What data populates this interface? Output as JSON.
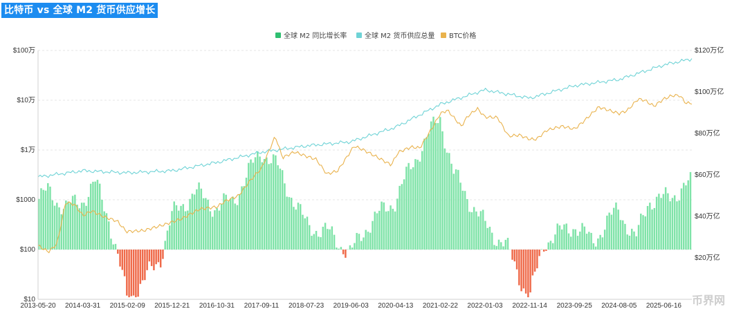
{
  "title": "比特币 vs 全球 M2 货币供应增长",
  "watermark": "币界网",
  "colors": {
    "title_bg": "#1c8cf0",
    "m2_growth_positive": "#7fe3a8",
    "m2_growth_negative": "#ef6a4a",
    "m2_supply": "#6fd3d6",
    "btc_price": "#e9b24c"
  },
  "chart_data": {
    "type": "bar",
    "title": "比特币 vs 全球 M2 货币供应增长",
    "legend": {
      "placement": "top-center",
      "items": [
        {
          "name": "全球 M2 同比增长率",
          "color": "#2fbf71",
          "icon": "square"
        },
        {
          "name": "全球 M2 货币供应总量",
          "color": "#6fd3d6",
          "icon": "square"
        },
        {
          "name": "BTC价格",
          "color": "#e9b24c",
          "icon": "square"
        }
      ]
    },
    "x_tick_labels": [
      "2013-05-20",
      "2014-03-31",
      "2015-02-09",
      "2015-12-21",
      "2016-10-31",
      "2017-09-11",
      "2018-07-23",
      "2019-06-03",
      "2020-04-13",
      "2021-02-22",
      "2022-01-03",
      "2022-11-14",
      "2023-09-25",
      "2024-08-05",
      "2025-06-16"
    ],
    "x_range": [
      "2013-05-20",
      "2025-12-31"
    ],
    "y_left": {
      "scale": "log",
      "tick_labels": [
        "$10",
        "$100",
        "$1000",
        "$1万",
        "$10万",
        "$100万"
      ],
      "range": [
        10,
        1000000
      ]
    },
    "y_right": {
      "scale": "linear",
      "tick_labels": [
        "$20万亿",
        "$40万亿",
        "$60万亿",
        "$80万亿",
        "$100万亿",
        "$120万亿"
      ],
      "range": [
        20,
        120
      ]
    },
    "grid": "horizontal-dashed",
    "series": [
      {
        "name": "BTC价格",
        "axis": "left",
        "type": "line",
        "points": [
          [
            "2013-05-20",
            120
          ],
          [
            "2013-08-01",
            90
          ],
          [
            "2013-10-01",
            130
          ],
          [
            "2013-12-01",
            900
          ],
          [
            "2014-02-01",
            800
          ],
          [
            "2014-04-01",
            480
          ],
          [
            "2014-06-01",
            600
          ],
          [
            "2014-09-01",
            450
          ],
          [
            "2014-12-01",
            370
          ],
          [
            "2015-02-01",
            230
          ],
          [
            "2015-06-01",
            240
          ],
          [
            "2015-11-01",
            320
          ],
          [
            "2016-03-01",
            420
          ],
          [
            "2016-07-01",
            650
          ],
          [
            "2016-11-01",
            720
          ],
          [
            "2017-01-01",
            950
          ],
          [
            "2017-04-01",
            1200
          ],
          [
            "2017-07-01",
            2600
          ],
          [
            "2017-09-11",
            4300
          ],
          [
            "2017-12-17",
            19000
          ],
          [
            "2018-02-06",
            7000
          ],
          [
            "2018-05-01",
            9200
          ],
          [
            "2018-07-23",
            7500
          ],
          [
            "2018-10-01",
            6500
          ],
          [
            "2018-12-15",
            3300
          ],
          [
            "2019-03-01",
            3800
          ],
          [
            "2019-06-26",
            12000
          ],
          [
            "2019-09-01",
            10000
          ],
          [
            "2019-12-01",
            7300
          ],
          [
            "2020-03-13",
            5000
          ],
          [
            "2020-05-01",
            9000
          ],
          [
            "2020-08-01",
            11500
          ],
          [
            "2020-10-01",
            11000
          ],
          [
            "2020-12-31",
            29000
          ],
          [
            "2021-02-22",
            54000
          ],
          [
            "2021-04-14",
            63000
          ],
          [
            "2021-07-20",
            30000
          ],
          [
            "2021-09-01",
            47000
          ],
          [
            "2021-11-10",
            68000
          ],
          [
            "2022-01-03",
            46000
          ],
          [
            "2022-04-01",
            45000
          ],
          [
            "2022-06-18",
            19000
          ],
          [
            "2022-09-01",
            20000
          ],
          [
            "2022-11-14",
            16500
          ],
          [
            "2023-01-01",
            16500
          ],
          [
            "2023-03-15",
            25000
          ],
          [
            "2023-07-01",
            30000
          ],
          [
            "2023-09-25",
            26300
          ],
          [
            "2023-12-01",
            38000
          ],
          [
            "2024-03-14",
            73000
          ],
          [
            "2024-08-05",
            54000
          ],
          [
            "2024-10-01",
            62000
          ],
          [
            "2024-12-17",
            106000
          ],
          [
            "2025-02-01",
            100000
          ],
          [
            "2025-04-08",
            76000
          ],
          [
            "2025-06-16",
            106000
          ],
          [
            "2025-08-14",
            124000
          ],
          [
            "2025-10-06",
            125000
          ],
          [
            "2025-11-20",
            87000
          ],
          [
            "2025-12-31",
            88000
          ]
        ]
      },
      {
        "name": "全球 M2 货币供应总量",
        "axis": "right",
        "type": "line",
        "points": [
          [
            "2013-05-20",
            59
          ],
          [
            "2014-03-31",
            62
          ],
          [
            "2015-02-09",
            61
          ],
          [
            "2015-12-21",
            62
          ],
          [
            "2016-10-31",
            66
          ],
          [
            "2017-09-11",
            71
          ],
          [
            "2018-07-23",
            74
          ],
          [
            "2019-06-03",
            76
          ],
          [
            "2020-04-13",
            83
          ],
          [
            "2021-02-22",
            94
          ],
          [
            "2022-01-03",
            101
          ],
          [
            "2022-11-14",
            97
          ],
          [
            "2023-09-25",
            103
          ],
          [
            "2024-08-05",
            106
          ],
          [
            "2025-06-16",
            113
          ],
          [
            "2025-12-31",
            116
          ]
        ]
      },
      {
        "name": "全球 M2 同比增长率",
        "axis": "left",
        "type": "bar",
        "unit": "% (displayed on log-scaled bar axis, baseline at $100)",
        "points": [
          [
            "2013-05-20",
            6
          ],
          [
            "2013-08-01",
            7
          ],
          [
            "2013-12-01",
            5
          ],
          [
            "2014-03-31",
            6
          ],
          [
            "2014-07-01",
            8
          ],
          [
            "2014-10-01",
            4
          ],
          [
            "2015-02-09",
            -6
          ],
          [
            "2015-06-01",
            -4
          ],
          [
            "2015-10-01",
            -1
          ],
          [
            "2015-12-21",
            4
          ],
          [
            "2016-06-01",
            7
          ],
          [
            "2016-10-31",
            5
          ],
          [
            "2017-03-01",
            6
          ],
          [
            "2017-09-11",
            12
          ],
          [
            "2018-01-01",
            10
          ],
          [
            "2018-07-23",
            3
          ],
          [
            "2019-01-01",
            2
          ],
          [
            "2019-06-03",
            -0.5
          ],
          [
            "2019-10-01",
            3
          ],
          [
            "2020-04-13",
            6
          ],
          [
            "2020-10-01",
            12
          ],
          [
            "2021-02-22",
            16
          ],
          [
            "2021-06-01",
            9
          ],
          [
            "2022-01-03",
            3
          ],
          [
            "2022-06-01",
            0.5
          ],
          [
            "2022-11-14",
            -6
          ],
          [
            "2023-03-01",
            1
          ],
          [
            "2023-09-25",
            3
          ],
          [
            "2024-02-01",
            1
          ],
          [
            "2024-08-05",
            5
          ],
          [
            "2024-12-01",
            1
          ],
          [
            "2025-03-01",
            6
          ],
          [
            "2025-06-16",
            6
          ],
          [
            "2025-12-31",
            8
          ]
        ]
      }
    ]
  }
}
